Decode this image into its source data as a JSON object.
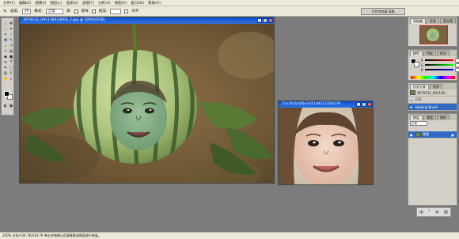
{
  "menubar": {
    "items": [
      "文件(F)",
      "编辑(E)",
      "图像(I)",
      "图层(L)",
      "选择(S)",
      "滤镜(T)",
      "分析(A)",
      "视图(V)",
      "窗口(W)",
      "帮助(H)"
    ]
  },
  "options": {
    "brush_label": "画笔:",
    "brush_size": "19",
    "mode_label": "模式:",
    "mode_value": "正常",
    "source_label": "源:",
    "source_sampled": "取样",
    "source_pattern": "图案:",
    "aligned_label": "对齐"
  },
  "dock_tab": "文件浏览器 画笔",
  "doc_main": {
    "title": "3970232_091136633000_2.jpg @ 100%(RGB)"
  },
  "doc_second": {
    "title": "21e7b1bd26e2d11d431232b139..."
  },
  "navigator": {
    "tabs": [
      "导航器",
      "信息",
      "直方图"
    ]
  },
  "color": {
    "tabs": [
      "颜色",
      "色板",
      "样式"
    ],
    "channels": [
      {
        "ch": "R",
        "val": "0",
        "color": "#e02020"
      },
      {
        "ch": "G",
        "val": "0",
        "color": "#20b020"
      },
      {
        "ch": "B",
        "val": "0",
        "color": "#2040e0"
      }
    ]
  },
  "history": {
    "tabs": [
      "历史记录",
      "动作"
    ],
    "items": [
      {
        "label": "3970232_091136...",
        "selected": false
      },
      {
        "label": "打开",
        "selected": false
      },
      {
        "label": "Healing Brush",
        "selected": true
      }
    ]
  },
  "layers": {
    "tabs": [
      "图层",
      "通道",
      "路径"
    ],
    "blend": "正常",
    "items": [
      {
        "label": "背景",
        "selected": true
      }
    ]
  },
  "zoombar": {
    "items": [
      "中",
      "°",
      "半",
      "简"
    ]
  },
  "status": {
    "text": "100% 文档:434.7K/434.7K 单击并拖移以用源像素或图案进行修复。"
  },
  "colors": {
    "titlebar": "#0a4fcf",
    "selection": "#316ac5",
    "panel": "#d4d0c8",
    "workspace": "#7c7c7c"
  }
}
